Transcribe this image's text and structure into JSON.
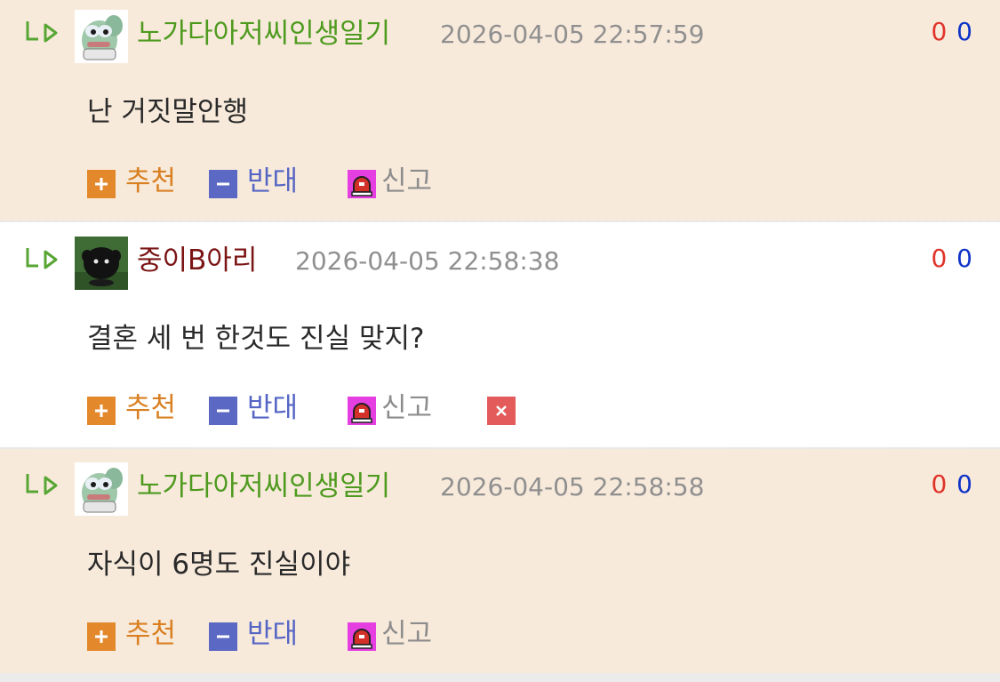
{
  "actions": {
    "recommend_label": "추천",
    "oppose_label": "반대",
    "report_label": "신고"
  },
  "comments": [
    {
      "nickname": "노가다아저씨인생일기",
      "nickname_color": "#4e9a1f",
      "avatar": "pepe-frog-avatar",
      "timestamp": "2026-04-05 22:57:59",
      "up_votes": "0",
      "down_votes": "0",
      "text": "난 거짓말안행",
      "background": "#f8eadb"
    },
    {
      "nickname": "중이B아리",
      "nickname_color": "#7b1414",
      "avatar": "dark-creature-avatar",
      "timestamp": "2026-04-05 22:58:38",
      "up_votes": "0",
      "down_votes": "0",
      "text": "결혼 세 번 한것도 진실 맞지?",
      "background": "#ffffff",
      "deletable": true
    },
    {
      "nickname": "노가다아저씨인생일기",
      "nickname_color": "#4e9a1f",
      "avatar": "pepe-frog-avatar",
      "timestamp": "2026-04-05 22:58:58",
      "up_votes": "0",
      "down_votes": "0",
      "text": "자식이 6명도 진실이야",
      "background": "#f8eadb"
    }
  ],
  "colors": {
    "recommend": "#e3892b",
    "oppose": "#5b68c4",
    "report": "#e63fe1",
    "delete": "#e35b5b",
    "up_vote": "#e0342a",
    "down_vote": "#1034c8",
    "reply_arrow": "#57a634"
  }
}
